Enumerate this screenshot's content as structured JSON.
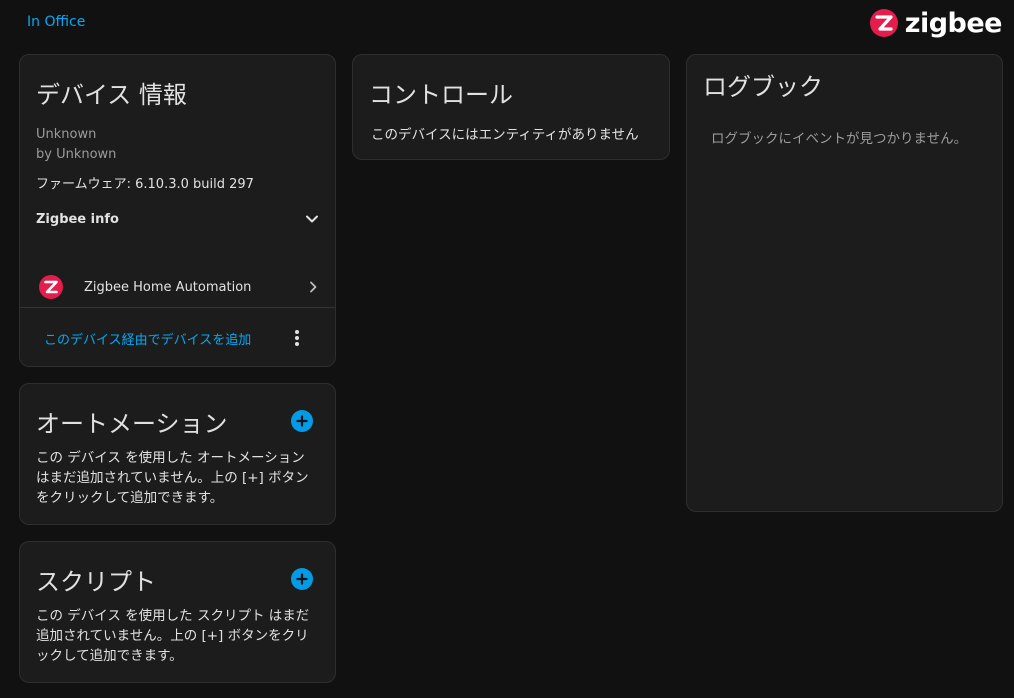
{
  "header": {
    "area_link": "In Office",
    "brand_name": "zigbee",
    "brand_color": "#e41d4c"
  },
  "device_info": {
    "title": "デバイス 情報",
    "model": "Unknown",
    "manufacturer": "by Unknown",
    "firmware": "ファームウェア: 6.10.3.0 build 297",
    "zigbee_info_label": "Zigbee info",
    "zigbee_info_icon": "chevron-down-icon",
    "integration_label": "Zigbee Home Automation",
    "integration_icon": "zigbee-logo-icon",
    "add_device_label": "このデバイス経由でデバイスを追加",
    "more_icon": "dots-vertical-icon"
  },
  "automation": {
    "title": "オートメーション",
    "add_icon": "plus-circle-icon",
    "empty_text": "この デバイス を使用した オートメーション はまだ追加されていません。上の [+] ボタンをクリックして追加できます。"
  },
  "script": {
    "title": "スクリプト",
    "add_icon": "plus-circle-icon",
    "empty_text": "この デバイス を使用した スクリプト はまだ追加されていません。上の [+] ボタンをクリックして追加できます。"
  },
  "controls": {
    "title": "コントロール",
    "empty_text": "このデバイスにはエンティティがありません"
  },
  "logbook": {
    "title": "ログブック",
    "empty_text": "ログブックにイベントが見つかりません。"
  },
  "colors": {
    "accent": "#03a9f4",
    "add_button": "#039be5",
    "background": "#111111",
    "card": "#1c1c1c"
  }
}
